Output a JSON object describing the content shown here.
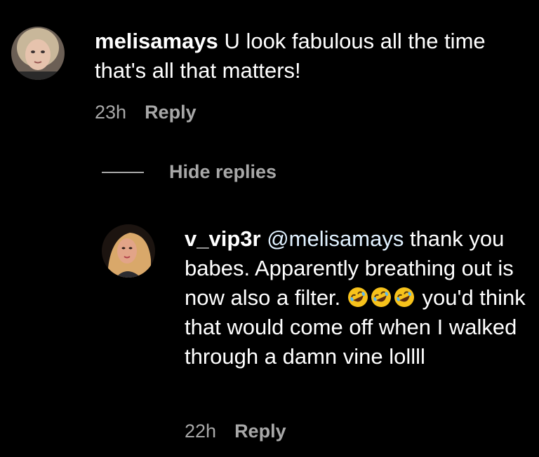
{
  "comment": {
    "username": "melisamays",
    "text": "U look fabulous all the time that's all that matters!",
    "time": "23h",
    "reply_label": "Reply"
  },
  "replies_toggle": {
    "label": "Hide replies"
  },
  "reply": {
    "username": "v_vip3r",
    "mention": "@melisamays",
    "text_before_emoji": "thank you babes. Apparently breathing out is now also a filter.",
    "emoji": [
      "rolling-on-floor-laughing-emoji",
      "rolling-on-floor-laughing-emoji",
      "rolling-on-floor-laughing-emoji"
    ],
    "text_after_emoji": "you'd think that would come off when I walked through a damn vine lollll",
    "time": "22h",
    "reply_label": "Reply"
  },
  "colors": {
    "background": "#000000",
    "text": "#ffffff",
    "secondary_text": "#a8a8a8",
    "mention": "#e0f1ff"
  }
}
